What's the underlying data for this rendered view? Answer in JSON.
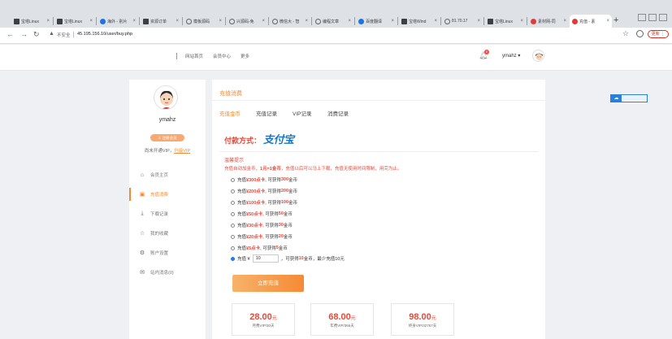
{
  "browser": {
    "tabs": [
      {
        "title": "宝塔Linux"
      },
      {
        "title": "宝塔Linux"
      },
      {
        "title": "海外 - 别片"
      },
      {
        "title": "资源订单"
      },
      {
        "title": "模板源码"
      },
      {
        "title": "兴源码-免"
      },
      {
        "title": "微信大 - 智"
      },
      {
        "title": "编程文章"
      },
      {
        "title": "百度翻译"
      },
      {
        "title": "宝塔Wind"
      },
      {
        "title": "81.70.17"
      },
      {
        "title": "宝塔Linux"
      },
      {
        "title": "素材网-同"
      },
      {
        "title": "充值 - 素"
      }
    ],
    "new_tab_label": "+",
    "not_secure_label": "不安全",
    "url": "45.195.156.10/user/buy.php",
    "update_label": "更新"
  },
  "header": {
    "nav": [
      "网站首页",
      "会员中心",
      "更多"
    ],
    "notification_count": "0",
    "username": "ymahz ▾"
  },
  "sidebar": {
    "username": "ymahz",
    "badge_label": "注册会员",
    "vip_text": "尚未开通VIP，",
    "vip_link": "升级VIP",
    "menu": [
      {
        "label": "会员主页",
        "icon": "home-icon"
      },
      {
        "label": "充值消费",
        "icon": "wallet-icon",
        "active": true
      },
      {
        "label": "下载记录",
        "icon": "download-icon"
      },
      {
        "label": "我的收藏",
        "icon": "star-icon"
      },
      {
        "label": "账户设置",
        "icon": "gear-icon"
      },
      {
        "label": "站内消息(0)",
        "icon": "mail-icon"
      }
    ]
  },
  "main": {
    "section_title": "充值消费",
    "tabs": [
      {
        "label": "充值金币",
        "active": true
      },
      {
        "label": "充值记录"
      },
      {
        "label": "VIP记录"
      },
      {
        "label": "消费记录"
      }
    ],
    "pay_method_label": "付款方式：",
    "pay_method_name": "支付宝",
    "tip_title": "温馨提示",
    "tip_text_prefix": "充值自动加金币，",
    "tip_text_bold": "1元=1金币",
    "tip_text_suffix": "，充值以后可以马上下载，充值无使用时间限制，用完为止。",
    "options": [
      {
        "pre": "充值 ",
        "amount": "¥300点卡",
        "mid": ", 可获得 ",
        "coins": "300",
        "post": " 金币"
      },
      {
        "pre": "充值 ",
        "amount": "¥200点卡",
        "mid": ", 可获得 ",
        "coins": "200",
        "post": " 金币"
      },
      {
        "pre": "充值 ",
        "amount": "¥100点卡",
        "mid": ", 可获得 ",
        "coins": "100",
        "post": " 金币"
      },
      {
        "pre": "充值 ",
        "amount": "¥50点卡",
        "mid": ", 可获得 ",
        "coins": "50",
        "post": " 金币"
      },
      {
        "pre": "充值 ",
        "amount": "¥30点卡",
        "mid": ", 可获得 ",
        "coins": "30",
        "post": " 金币"
      },
      {
        "pre": "充值 ",
        "amount": "¥20点卡",
        "mid": ", 可获得 ",
        "coins": "20",
        "post": " 金币"
      },
      {
        "pre": "充值 ",
        "amount": "¥5点卡",
        "mid": ", 可获得 ",
        "coins": "5",
        "post": " 金币"
      }
    ],
    "custom": {
      "pre": "充值 ¥",
      "value": "10",
      "mid": "，可获得 ",
      "coins": "10",
      "post": " 金币，最少充值10元"
    },
    "submit_label": "立即充值",
    "vip_cards": [
      {
        "price": "28.00",
        "unit": "元",
        "label": "月费VIP/30天"
      },
      {
        "price": "68.00",
        "unit": "元",
        "label": "年费VIP/366天"
      },
      {
        "price": "98.00",
        "unit": "元",
        "label": "终身VIP/32767天"
      }
    ]
  },
  "colors": {
    "accent": "#f08a37",
    "highlight_red": "#e04b3c",
    "alipay_blue": "#1677c9"
  }
}
